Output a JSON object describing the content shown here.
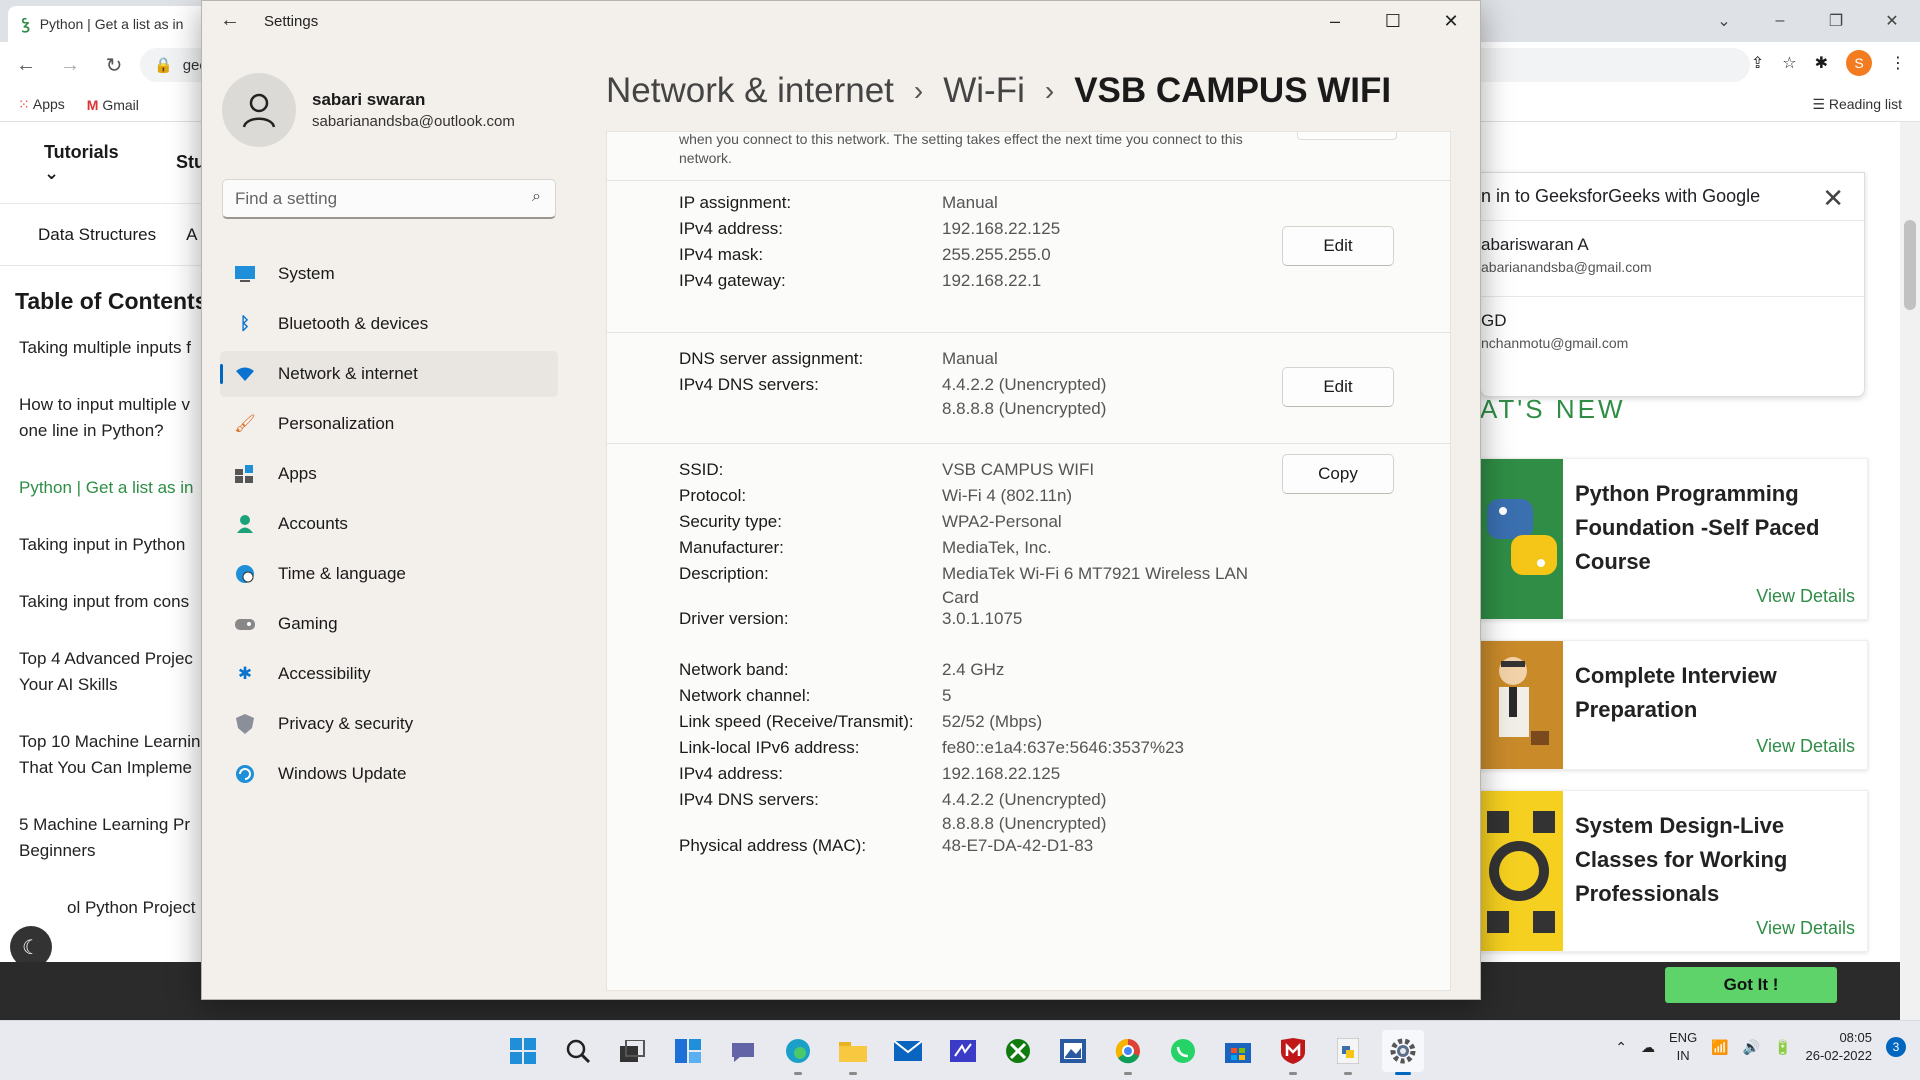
{
  "browser": {
    "tab_title": "Python | Get a list as in",
    "tab_logo": "Ꝣ",
    "url_fragment": "gee",
    "profile_initial": "S",
    "bookmarks": [
      "Apps",
      "Gmail"
    ],
    "reading_list": "Reading list"
  },
  "site": {
    "nav": [
      "Tutorials",
      "Stu"
    ],
    "subnav": [
      "Data Structures",
      "A"
    ],
    "toc_title": "Table of Contents",
    "toc": [
      "Taking multiple inputs f",
      "How to input multiple v",
      "one line in Python?",
      "Python | Get a list as in",
      "Taking input in Python",
      "Taking input from cons",
      "Top 4 Advanced Projec",
      "Your AI Skills",
      "Top 10 Machine Learnin",
      "That You Can Impleme",
      "5 Machine Learning Pr",
      "Beginners",
      "ol Python Project Id"
    ],
    "signin": {
      "header": "n in to GeeksforGeeks with Google",
      "accounts": [
        {
          "name": "abariswaran A",
          "email": "abarianandsba@gmail.com"
        },
        {
          "name": "GD",
          "email": "nchanmotu@gmail.com"
        }
      ]
    },
    "whats_new": "AT'S NEW",
    "courses": [
      {
        "title": "Python Programming Foundation -Self Paced Course",
        "link": "View Details"
      },
      {
        "title": "Complete Interview Preparation",
        "link": "View Details"
      },
      {
        "title": "System Design-Live Classes for Working Professionals",
        "link": "View Details"
      }
    ],
    "got_it": "Got It !"
  },
  "settings": {
    "window_title": "Settings",
    "user": {
      "name": "sabari swaran",
      "email": "sabarianandsba@outlook.com"
    },
    "search_placeholder": "Find a setting",
    "nav": [
      {
        "label": "System",
        "icon": "monitor-icon"
      },
      {
        "label": "Bluetooth & devices",
        "icon": "bluetooth-icon"
      },
      {
        "label": "Network & internet",
        "icon": "wifi-icon",
        "selected": true
      },
      {
        "label": "Personalization",
        "icon": "brush-icon"
      },
      {
        "label": "Apps",
        "icon": "apps-icon"
      },
      {
        "label": "Accounts",
        "icon": "person-icon"
      },
      {
        "label": "Time & language",
        "icon": "globe-clock-icon"
      },
      {
        "label": "Gaming",
        "icon": "gamepad-icon"
      },
      {
        "label": "Accessibility",
        "icon": "accessibility-icon"
      },
      {
        "label": "Privacy & security",
        "icon": "shield-icon"
      },
      {
        "label": "Windows Update",
        "icon": "update-icon"
      }
    ],
    "breadcrumb": [
      "Network & internet",
      "Wi-Fi",
      "VSB CAMPUS WIFI"
    ],
    "note": "when you connect to this network. The setting takes effect the next time you connect to this network.",
    "ip": {
      "assignment_label": "IP assignment:",
      "assignment": "Manual",
      "ipv4_label": "IPv4 address:",
      "ipv4": "192.168.22.125",
      "mask_label": "IPv4 mask:",
      "mask": "255.255.255.0",
      "gateway_label": "IPv4 gateway:",
      "gateway": "192.168.22.1",
      "edit": "Edit"
    },
    "dns": {
      "assignment_label": "DNS server assignment:",
      "assignment": "Manual",
      "servers_label": "IPv4 DNS servers:",
      "server1": "4.4.2.2 (Unencrypted)",
      "server2": "8.8.8.8 (Unencrypted)",
      "edit": "Edit"
    },
    "props": {
      "copy": "Copy",
      "items": [
        {
          "label": "SSID:",
          "value": "VSB CAMPUS WIFI"
        },
        {
          "label": "Protocol:",
          "value": "Wi-Fi 4 (802.11n)"
        },
        {
          "label": "Security type:",
          "value": "WPA2-Personal"
        },
        {
          "label": "Manufacturer:",
          "value": "MediaTek, Inc."
        },
        {
          "label": "Description:",
          "value": "MediaTek Wi-Fi 6 MT7921 Wireless LAN Card"
        },
        {
          "label": "Driver version:",
          "value": "3.0.1.1075"
        },
        {
          "label": "Network band:",
          "value": "2.4 GHz"
        },
        {
          "label": "Network channel:",
          "value": "5"
        },
        {
          "label": "Link speed (Receive/Transmit):",
          "value": "52/52 (Mbps)"
        },
        {
          "label": "Link-local IPv6 address:",
          "value": "fe80::e1a4:637e:5646:3537%23"
        },
        {
          "label": "IPv4 address:",
          "value": "192.168.22.125"
        },
        {
          "label": "IPv4 DNS servers:",
          "value": "4.4.2.2 (Unencrypted)",
          "value2": "8.8.8.8 (Unencrypted)"
        },
        {
          "label": "Physical address (MAC):",
          "value": "48-E7-DA-42-D1-83"
        }
      ]
    }
  },
  "taskbar": {
    "lang1": "ENG",
    "lang2": "IN",
    "time": "08:05",
    "date": "26-02-2022",
    "notifications": "3"
  }
}
